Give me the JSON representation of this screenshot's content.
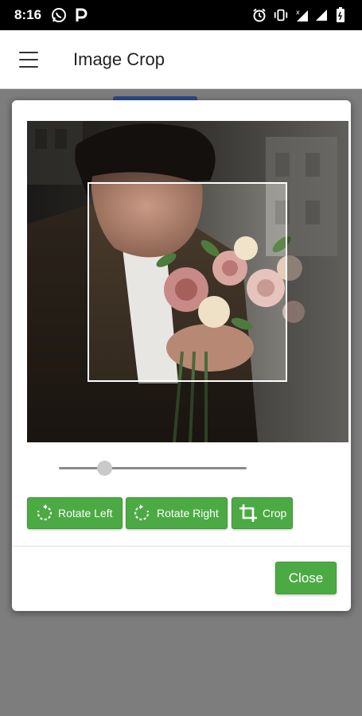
{
  "status_bar": {
    "time": "8:16",
    "icons": [
      "whatsapp-icon",
      "parking-icon",
      "alarm-icon",
      "vibrate-icon",
      "signal-icon",
      "signal-icon",
      "battery-icon"
    ]
  },
  "app_bar": {
    "title": "Image Crop",
    "menu_icon": "hamburger-menu-icon"
  },
  "dialog": {
    "image": {
      "subject": "photo",
      "crop_overlay": "square"
    },
    "slider": {
      "value_fraction": 0.24
    },
    "buttons": {
      "rotate_left": {
        "label": "Rotate Left",
        "icon": "rotate-left-icon"
      },
      "rotate_right": {
        "label": "Rotate Right",
        "icon": "rotate-right-icon"
      },
      "crop": {
        "label": "Crop",
        "icon": "crop-icon"
      }
    },
    "close_label": "Close"
  },
  "colors": {
    "accent_green": "#4caa44",
    "app_bar_bg": "#ffffff",
    "scrim": "#7d7d7d"
  }
}
